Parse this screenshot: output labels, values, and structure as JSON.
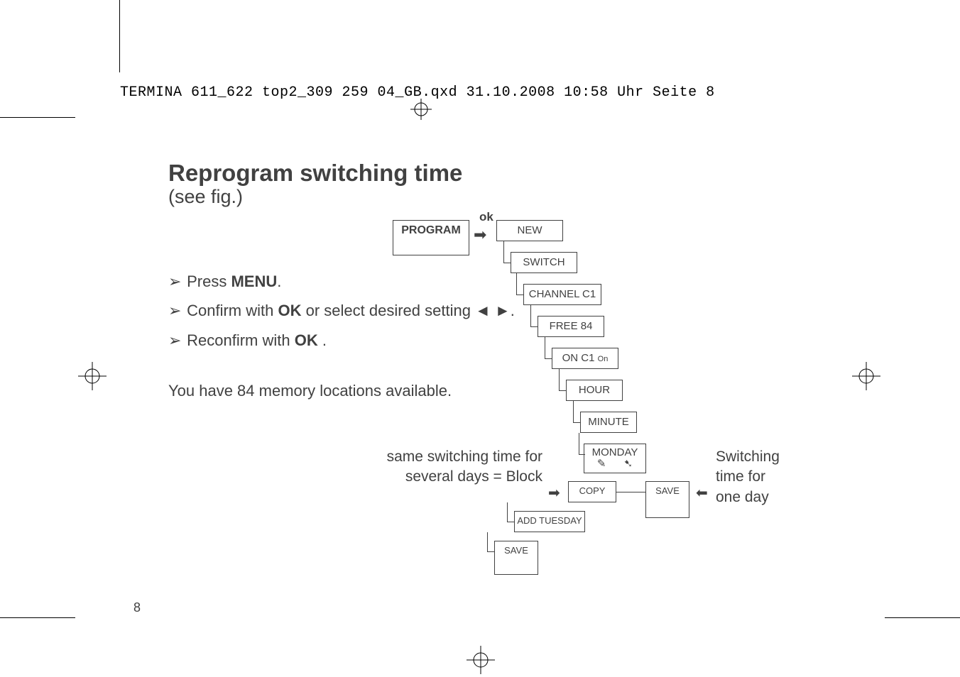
{
  "header": "TERMINA 611_622 top2_309 259 04_GB.qxd  31.10.2008  10:58 Uhr  Seite 8",
  "title": "Reprogram switching time",
  "subtitle": "(see fig.)",
  "instructions": {
    "press": "Press ",
    "menu_bold": "MENU",
    "period": ".",
    "confirm_pre": "Confirm with ",
    "ok_bold": "OK",
    "confirm_post": " or select desired setting ◄ ►.",
    "reconfirm_pre": "Reconfirm with ",
    "reconfirm_post": " ."
  },
  "memory_line": "You have 84 memory locations available.",
  "ok_label": "ok",
  "boxes": {
    "program": "PROGRAM",
    "new": "NEW",
    "switch": "SWITCH",
    "channel": "CHANNEL C1",
    "free": "FREE 84",
    "onc1": "ON C1",
    "onc1_sub": "On",
    "hour": "HOUR",
    "minute": "MINUTE",
    "monday": "MONDAY",
    "copy": "COPY",
    "save": "SAVE",
    "addtue": "ADD TUESDAY"
  },
  "labels": {
    "same_l1": "same switching time for",
    "same_l2": "several days = Block",
    "switching_l1": "Switching",
    "switching_l2": "time for",
    "switching_l3": "one day"
  },
  "page_num": "8"
}
